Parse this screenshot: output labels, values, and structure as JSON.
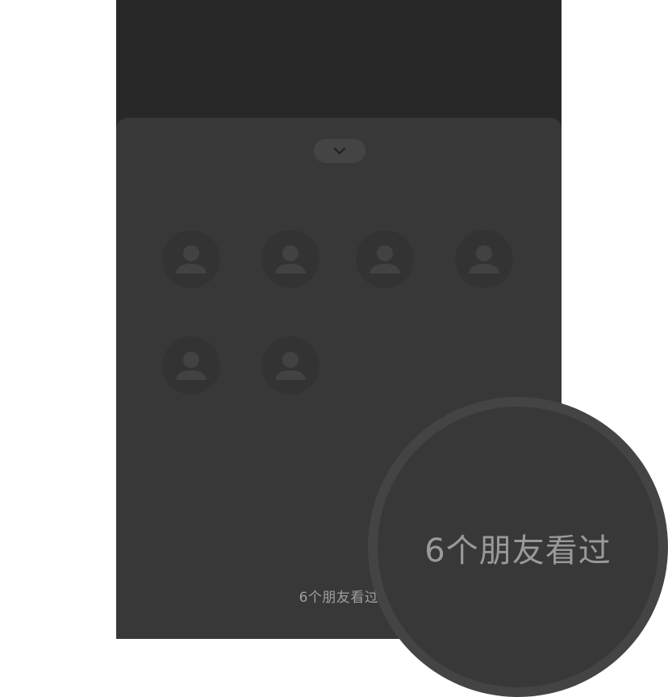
{
  "sheet": {
    "collapse_icon": "chevron-down-icon",
    "viewers": [
      {
        "icon": "default-avatar-icon"
      },
      {
        "icon": "default-avatar-icon"
      },
      {
        "icon": "default-avatar-icon"
      },
      {
        "icon": "default-avatar-icon"
      },
      {
        "icon": "default-avatar-icon"
      },
      {
        "icon": "default-avatar-icon"
      }
    ],
    "viewed_by_text": "6个朋友看过"
  },
  "magnifier": {
    "text": "6个朋友看过"
  },
  "colors": {
    "top_background": "#282828",
    "sheet_background": "#383838",
    "avatar_background": "#333333",
    "avatar_silhouette": "#424242",
    "text": "#a0a0a0"
  }
}
